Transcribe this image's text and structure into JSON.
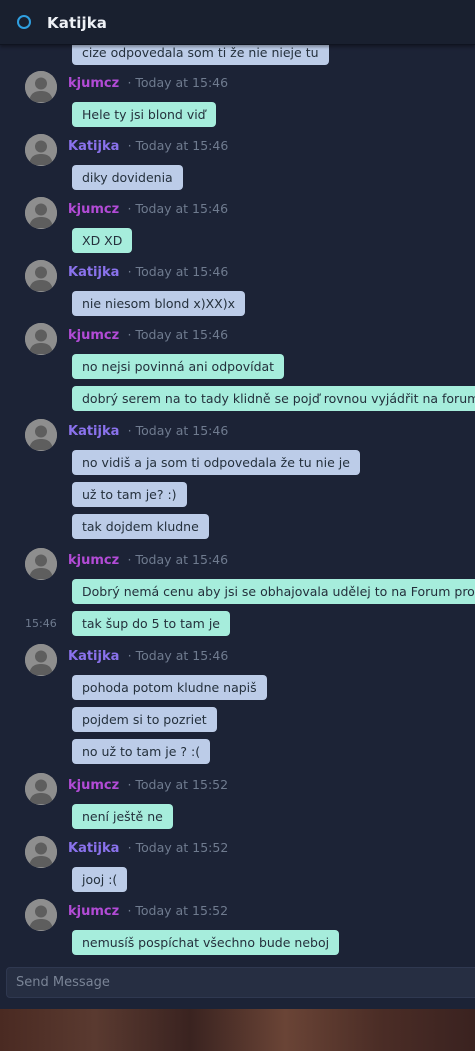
{
  "header": {
    "title": "Katijka"
  },
  "colors": {
    "accent": "#2f9fe0",
    "kjumcz_bubble": "#a6eddc",
    "katijka_bubble": "#bccce8"
  },
  "partial_message": {
    "text": "cize odpovedala som ti že nie nieje tu"
  },
  "groups": [
    {
      "user": "kjumcz",
      "time": "· Today at 15:46",
      "messages": [
        "Hele ty jsi blond viď"
      ]
    },
    {
      "user": "Katijka",
      "time": "· Today at 15:46",
      "messages": [
        "diky dovidenia"
      ]
    },
    {
      "user": "kjumcz",
      "time": "· Today at 15:46",
      "messages": [
        "XD XD"
      ]
    },
    {
      "user": "Katijka",
      "time": "· Today at 15:46",
      "messages": [
        "nie niesom blond x)XX)x"
      ]
    },
    {
      "user": "kjumcz",
      "time": "· Today at 15:46",
      "messages": [
        "no nejsi povinná ani odpovídat",
        "dobrý serem na to tady klidně se pojď rovnou vyjádřit na forum"
      ]
    },
    {
      "user": "Katijka",
      "time": "· Today at 15:46",
      "messages": [
        "no vidiš a ja som ti odpovedala že tu nie je",
        "už to tam je? :)",
        "tak dojdem kludne"
      ]
    },
    {
      "user": "kjumcz",
      "time": "· Today at 15:46",
      "messages": [
        "Dobrý nemá cenu aby jsi se obhajovala udělej to na Forum prosím",
        "tak šup do 5 to tam je"
      ],
      "side_time": "15:46"
    },
    {
      "user": "Katijka",
      "time": "· Today at 15:46",
      "messages": [
        "pohoda potom kludne napiš",
        "pojdem si to pozriet",
        "no už to tam je ? :("
      ]
    },
    {
      "user": "kjumcz",
      "time": "· Today at 15:52",
      "messages": [
        "není ještě ne"
      ]
    },
    {
      "user": "Katijka",
      "time": "· Today at 15:52",
      "messages": [
        "jooj :("
      ]
    },
    {
      "user": "kjumcz",
      "time": "· Today at 15:52",
      "messages": [
        "nemusíš pospíchat všechno bude neboj"
      ]
    }
  ],
  "composer": {
    "placeholder": "Send Message"
  }
}
